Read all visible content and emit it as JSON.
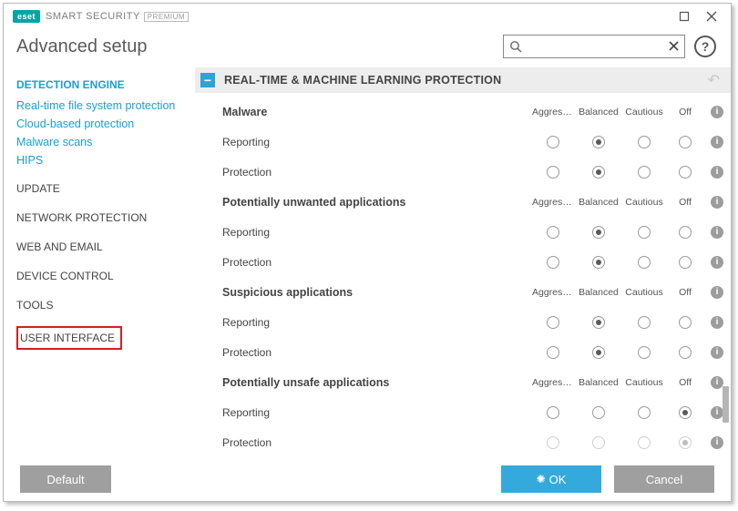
{
  "titlebar": {
    "brand": "eset",
    "product": "SMART SECURITY",
    "edition": "PREMIUM"
  },
  "header": {
    "title": "Advanced setup"
  },
  "search": {
    "placeholder": "",
    "value": ""
  },
  "sidebar": {
    "active": "DETECTION ENGINE",
    "subs": [
      "Real-time file system protection",
      "Cloud-based protection",
      "Malware scans",
      "HIPS"
    ],
    "cats": [
      "UPDATE",
      "NETWORK PROTECTION",
      "WEB AND EMAIL",
      "DEVICE CONTROL",
      "TOOLS",
      "USER INTERFACE"
    ],
    "highlight": "USER INTERFACE"
  },
  "section": {
    "title": "REAL-TIME & MACHINE LEARNING PROTECTION"
  },
  "columns": [
    "Aggress...",
    "Balanced",
    "Cautious",
    "Off"
  ],
  "groups": [
    {
      "name": "Malware",
      "rows": [
        {
          "label": "Reporting",
          "sel": 1,
          "disabled": false
        },
        {
          "label": "Protection",
          "sel": 1,
          "disabled": false
        }
      ]
    },
    {
      "name": "Potentially unwanted applications",
      "rows": [
        {
          "label": "Reporting",
          "sel": 1,
          "disabled": false
        },
        {
          "label": "Protection",
          "sel": 1,
          "disabled": false
        }
      ]
    },
    {
      "name": "Suspicious applications",
      "rows": [
        {
          "label": "Reporting",
          "sel": 1,
          "disabled": false
        },
        {
          "label": "Protection",
          "sel": 1,
          "disabled": false
        }
      ]
    },
    {
      "name": "Potentially unsafe applications",
      "rows": [
        {
          "label": "Reporting",
          "sel": 3,
          "disabled": false
        },
        {
          "label": "Protection",
          "sel": 3,
          "disabled": true
        }
      ]
    }
  ],
  "footer": {
    "default": "Default",
    "ok": "OK",
    "cancel": "Cancel"
  }
}
